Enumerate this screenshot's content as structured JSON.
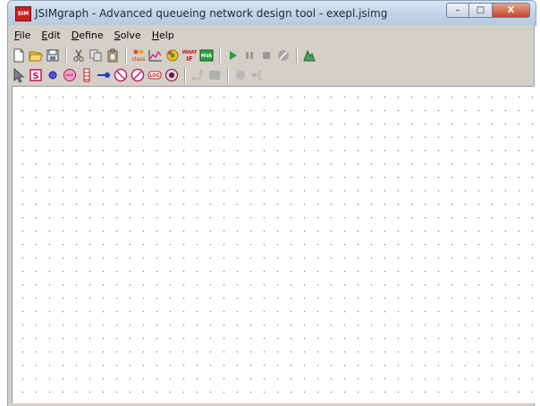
{
  "window": {
    "title": "JSIMgraph - Advanced queueing network design tool - exepl.jsimg",
    "app_icon_label": "SIM",
    "controls": {
      "minimize": "–",
      "maximize": "□",
      "close": "X"
    }
  },
  "menu": [
    {
      "hot": "F",
      "rest": "ile"
    },
    {
      "hot": "E",
      "rest": "dit"
    },
    {
      "hot": "D",
      "rest": "efine"
    },
    {
      "hot": "S",
      "rest": "olve"
    },
    {
      "hot": "H",
      "rest": "elp"
    }
  ],
  "toolbar_main": [
    "new-file-icon",
    "open-folder-icon",
    "save-icon",
    "sep",
    "cut-icon",
    "copy-icon",
    "paste-icon",
    "sep",
    "class-icon",
    "chart-icon",
    "gear-icon",
    "what-if-icon",
    "mva-icon",
    "sep",
    "play-icon",
    "pause-icon",
    "stop-icon",
    "stop-circle-icon",
    "sep",
    "reports-icon"
  ],
  "toolbar_draw": [
    "select-arrow-icon",
    "source-icon",
    "sink-icon",
    "queue-station-icon",
    "delay-icon",
    "router-icon",
    "fork-icon",
    "join-icon",
    "logger-icon",
    "finite-capacity-icon",
    "sep",
    "connect-icon",
    "blocking-region-icon",
    "sep",
    "station-icon",
    "link-icon"
  ],
  "labels": {
    "class_icon": "class",
    "what_icon": "WHAT",
    "if_icon": "IF",
    "mva_icon": "MVA",
    "log_icon": "LOG",
    "source_icon": "S"
  }
}
